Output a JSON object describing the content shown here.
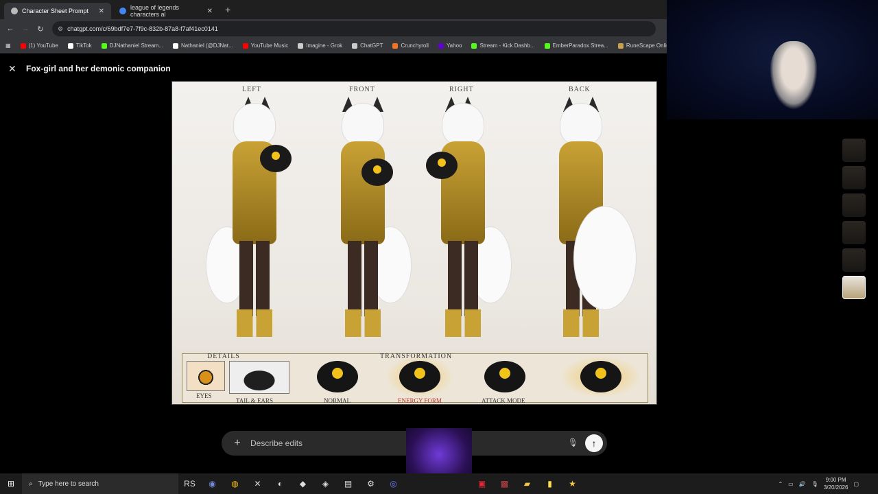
{
  "browser": {
    "tabs": [
      {
        "label": "Character Sheet Prompt",
        "active": true
      },
      {
        "label": "league of legends characters al",
        "active": false
      }
    ],
    "url": "chatgpt.com/c/69bdf7e7-7f9c-832b-87a8-f7af41ec0141",
    "bookmarks": [
      {
        "label": "(1) YouTube",
        "color": "#ff0000"
      },
      {
        "label": "TikTok",
        "color": "#ffffff"
      },
      {
        "label": "DJNathaniel Stream...",
        "color": "#53fc18"
      },
      {
        "label": "Nathaniel (@DJNat...",
        "color": "#ffffff"
      },
      {
        "label": "YouTube Music",
        "color": "#ff0000"
      },
      {
        "label": "Imagine - Grok",
        "color": "#cccccc"
      },
      {
        "label": "ChatGPT",
        "color": "#cccccc"
      },
      {
        "label": "Crunchyroll",
        "color": "#f47521"
      },
      {
        "label": "Yahoo",
        "color": "#6001d2"
      },
      {
        "label": "Stream - Kick Dashb...",
        "color": "#53fc18"
      },
      {
        "label": "EmberParadox Strea...",
        "color": "#53fc18"
      },
      {
        "label": "RuneScape Online",
        "color": "#c8a24a"
      }
    ]
  },
  "page": {
    "title": "Fox-girl and her demonic companion",
    "artwork": {
      "views": [
        "LEFT",
        "FRONT",
        "RIGHT",
        "BACK"
      ],
      "details_label": "DETAILS",
      "transformation_label": "TRANSFORMATION",
      "eyes_label": "EYES",
      "tail_ears_label": "TAIL & EARS",
      "forms": [
        "NORMAL",
        "ENERGY FORM",
        "ATTACK MODE",
        ""
      ]
    },
    "thumbnail_count": 6
  },
  "prompt": {
    "placeholder": "Describe edits",
    "value": ""
  },
  "taskbar": {
    "search_placeholder": "Type here to search",
    "time": "9:00 PM",
    "date": "3/20/2026"
  }
}
